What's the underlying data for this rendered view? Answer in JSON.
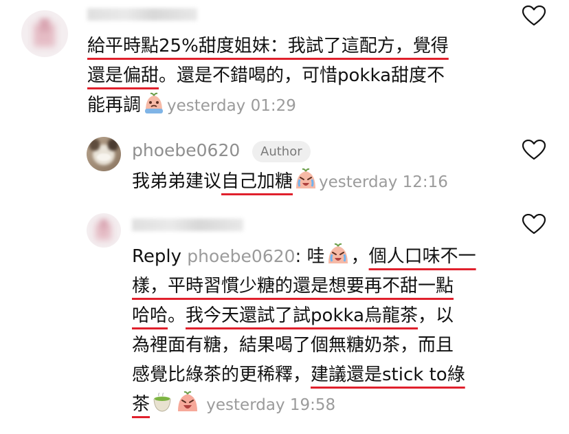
{
  "comment1": {
    "lines": [
      [
        "給平時點25%甜度姐妹：我試了這配方，覺得"
      ],
      [
        "還是偏甜",
        "。還是不錯喝的，可惜pokka甜度不"
      ],
      [
        "能再調"
      ]
    ],
    "timestamp": "yesterday 01:29"
  },
  "reply1": {
    "username": "phoebe0620",
    "badge": "Author",
    "text_plain": "我弟弟建议",
    "text_underlined": "自己加糖",
    "timestamp": "yesterday 12:16"
  },
  "reply2": {
    "reply_label": "Reply",
    "mention": "phoebe0620",
    "colon_text": ": 哇",
    "l1_after": "，",
    "l1_ul": "個人口味不一",
    "l2_ul": "樣，平時習慣少糖的還是想要再不甜一點",
    "l3_ul_a": "哈哈",
    "l3_plain": "。",
    "l3_ul_b": "我今天還試了試pokka烏龍茶",
    "l3_end": "，以",
    "l4": "為裡面有糖，結果喝了個無糖奶茶，而且",
    "l5_plain": "感覺比綠茶的更稀釋，",
    "l5_ul": "建議還是stick to綠",
    "l6_ul": "茶",
    "timestamp": "yesterday 19:58"
  },
  "colors": {
    "underline": "#e0202c",
    "meta": "#9b9b9b",
    "text": "#111111"
  },
  "icons": [
    "heart-outline-icon",
    "crying-emoji-icon",
    "green-tea-emoji-icon"
  ]
}
